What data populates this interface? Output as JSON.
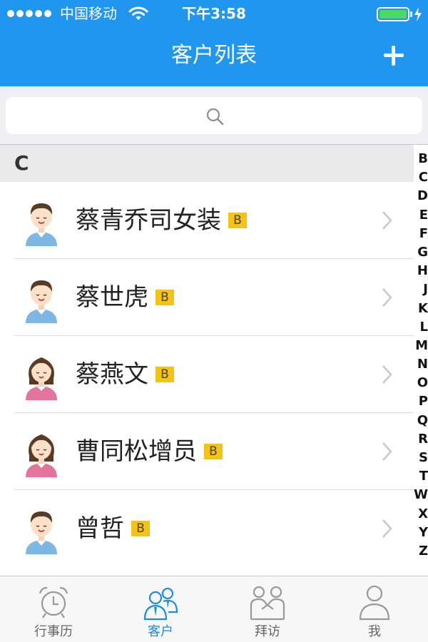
{
  "status_bar": {
    "carrier": "中国移动",
    "time": "下午3:58"
  },
  "nav": {
    "title": "客户列表",
    "add_icon": "plus-icon"
  },
  "search": {
    "placeholder": "",
    "icon": "search-icon"
  },
  "section": {
    "letter": "C"
  },
  "customers": [
    {
      "name": "蔡青乔司女装",
      "badge": "B",
      "avatar": "male"
    },
    {
      "name": "蔡世虎",
      "badge": "B",
      "avatar": "male"
    },
    {
      "name": "蔡燕文",
      "badge": "B",
      "avatar": "female"
    },
    {
      "name": "曹同松增员",
      "badge": "B",
      "avatar": "female"
    },
    {
      "name": "曾哲",
      "badge": "B",
      "avatar": "male"
    }
  ],
  "index_letters": [
    "B",
    "C",
    "D",
    "E",
    "F",
    "G",
    "H",
    "J",
    "K",
    "L",
    "M",
    "N",
    "O",
    "P",
    "Q",
    "R",
    "S",
    "T",
    "W",
    "X",
    "Y",
    "Z"
  ],
  "tabs": [
    {
      "label": "行事历",
      "icon": "alarm-clock-icon",
      "active": false
    },
    {
      "label": "客户",
      "icon": "customers-icon",
      "active": true
    },
    {
      "label": "拜访",
      "icon": "handshake-icon",
      "active": false
    },
    {
      "label": "我",
      "icon": "person-icon",
      "active": false
    }
  ],
  "colors": {
    "header_blue": "#2196EE",
    "badge_yellow": "#F5C315",
    "active_tab": "#1E8BE0",
    "battery_green": "#4CD964"
  }
}
